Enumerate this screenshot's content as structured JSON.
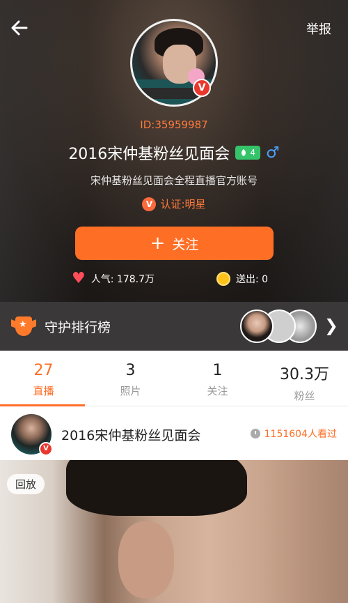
{
  "header": {
    "report_label": "举报",
    "user_id": "ID:35959987",
    "name": "2016宋仲基粉丝见面会",
    "level": "4",
    "gender_symbol": "♂",
    "bio": "宋仲基粉丝见面会全程直播官方账号",
    "verify_text": "认证:明星",
    "follow_label": "关注",
    "popularity": "人气: 178.7万",
    "sent": "送出: 0"
  },
  "guardian": {
    "label": "守护排行榜"
  },
  "tabs": [
    {
      "count": "27",
      "label": "直播",
      "active": true
    },
    {
      "count": "3",
      "label": "照片",
      "active": false
    },
    {
      "count": "1",
      "label": "关注",
      "active": false
    },
    {
      "count": "30.3万",
      "label": "粉丝",
      "active": false
    }
  ],
  "live_item": {
    "title": "2016宋仲基粉丝见面会",
    "viewers": "1151604人看过"
  },
  "video": {
    "replay_label": "回放"
  },
  "colors": {
    "accent": "#ff6e25",
    "level_badge": "#35c46a",
    "gender": "#4aa3ff",
    "verify_red": "#e8382e"
  }
}
